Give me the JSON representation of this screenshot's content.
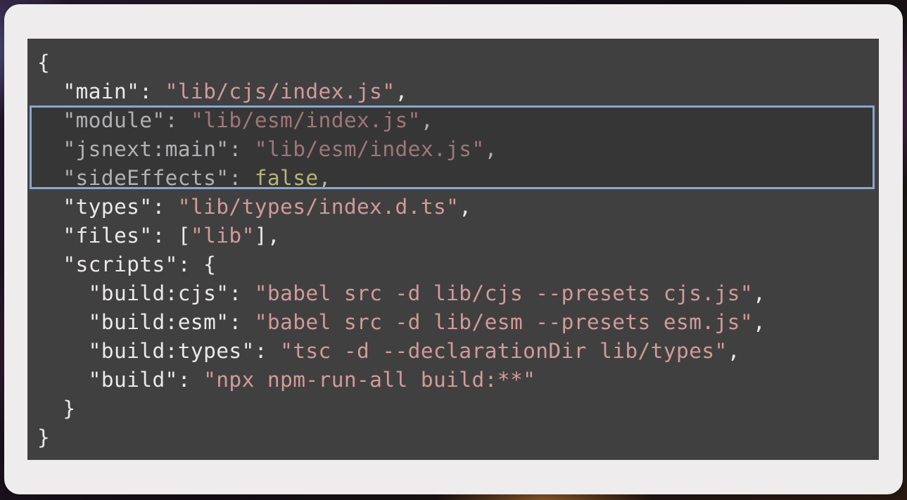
{
  "code": {
    "lines": [
      [
        {
          "t": "{",
          "c": "p"
        }
      ],
      [
        {
          "t": "  \"main\": ",
          "c": "p"
        },
        {
          "t": "\"lib/cjs/index.js\"",
          "c": "s"
        },
        {
          "t": ",",
          "c": "p"
        }
      ],
      [
        {
          "t": "  \"module\": ",
          "c": "p"
        },
        {
          "t": "\"lib/esm/index.js\"",
          "c": "s"
        },
        {
          "t": ",",
          "c": "p"
        }
      ],
      [
        {
          "t": "  \"jsnext:main\": ",
          "c": "p"
        },
        {
          "t": "\"lib/esm/index.js\"",
          "c": "s"
        },
        {
          "t": ",",
          "c": "p"
        }
      ],
      [
        {
          "t": "  \"sideEffects\": ",
          "c": "p"
        },
        {
          "t": "false",
          "c": "b"
        },
        {
          "t": ",",
          "c": "p"
        }
      ],
      [
        {
          "t": "  \"types\": ",
          "c": "p"
        },
        {
          "t": "\"lib/types/index.d.ts\"",
          "c": "s"
        },
        {
          "t": ",",
          "c": "p"
        }
      ],
      [
        {
          "t": "  \"files\": [",
          "c": "p"
        },
        {
          "t": "\"lib\"",
          "c": "s"
        },
        {
          "t": "],",
          "c": "p"
        }
      ],
      [
        {
          "t": "  \"scripts\": {",
          "c": "p"
        }
      ],
      [
        {
          "t": "    \"build:cjs\": ",
          "c": "p"
        },
        {
          "t": "\"babel src -d lib/cjs --presets cjs.js\"",
          "c": "s"
        },
        {
          "t": ",",
          "c": "p"
        }
      ],
      [
        {
          "t": "    \"build:esm\": ",
          "c": "p"
        },
        {
          "t": "\"babel src -d lib/esm --presets esm.js\"",
          "c": "s"
        },
        {
          "t": ",",
          "c": "p"
        }
      ],
      [
        {
          "t": "    \"build:types\": ",
          "c": "p"
        },
        {
          "t": "\"tsc -d --declarationDir lib/types\"",
          "c": "s"
        },
        {
          "t": ",",
          "c": "p"
        }
      ],
      [
        {
          "t": "    \"build\": ",
          "c": "p"
        },
        {
          "t": "\"npx npm-run-all build:**\"",
          "c": "s"
        }
      ],
      [
        {
          "t": "  }",
          "c": "p"
        }
      ],
      [
        {
          "t": "}",
          "c": "p"
        }
      ]
    ],
    "highlighted_lines": [
      2,
      3,
      4
    ]
  },
  "colors": {
    "panel_background": "#414041",
    "punctuation": "#ece9ea",
    "string": "#d29a9a",
    "boolean": "#f3ed9d",
    "highlight_border": "#8aa6cf",
    "card_background": "#efeced"
  }
}
